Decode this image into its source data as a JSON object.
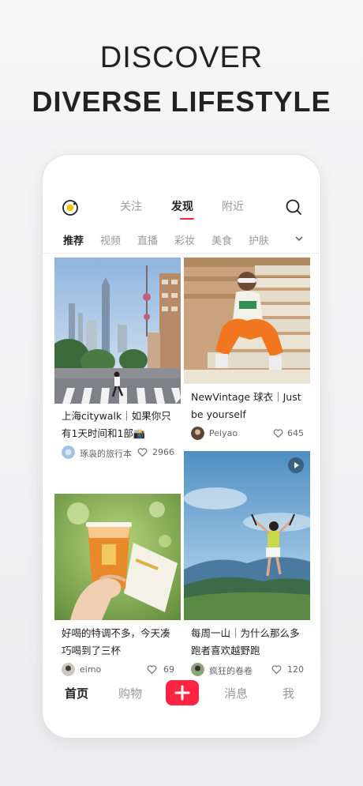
{
  "headline": {
    "line1": "DISCOVER",
    "line2": "DIVERSE LIFESTYLE"
  },
  "top_nav": {
    "tabs": [
      {
        "label": "关注",
        "active": false
      },
      {
        "label": "发现",
        "active": true
      },
      {
        "label": "附近",
        "active": false
      }
    ],
    "logo_icon": "camera-lens-icon",
    "search_icon": "search-icon"
  },
  "categories": {
    "items": [
      {
        "label": "推荐",
        "active": true
      },
      {
        "label": "视频",
        "active": false
      },
      {
        "label": "直播",
        "active": false
      },
      {
        "label": "彩妆",
        "active": false
      },
      {
        "label": "美食",
        "active": false
      },
      {
        "label": "护肤",
        "active": false
      }
    ],
    "more_icon": "chevron-down-icon"
  },
  "feed": {
    "cards": [
      {
        "title": "上海citywalk｜如果你只有1天时间和1部📸",
        "author": "琢袅的旅行本",
        "likes": "2966",
        "is_video": false
      },
      {
        "title": "NewVintage 球衣｜Just be yourself",
        "author": "Peiyao",
        "likes": "645",
        "is_video": false
      },
      {
        "title": "好喝的特调不多，今天凑巧喝到了三杯",
        "author": "eimo",
        "likes": "69",
        "is_video": false
      },
      {
        "title": "每周一山｜为什么那么多跑者喜欢越野跑",
        "author": "疯狂的卷卷",
        "likes": "120",
        "is_video": true
      }
    ]
  },
  "bottom_nav": {
    "items": [
      {
        "label": "首页",
        "active": true
      },
      {
        "label": "购物",
        "active": false
      },
      {
        "label": "消息",
        "active": false
      },
      {
        "label": "我",
        "active": false
      }
    ],
    "add_icon": "plus-icon"
  },
  "colors": {
    "accent": "#ff2442",
    "text_primary": "#222222",
    "text_secondary": "#999999"
  }
}
